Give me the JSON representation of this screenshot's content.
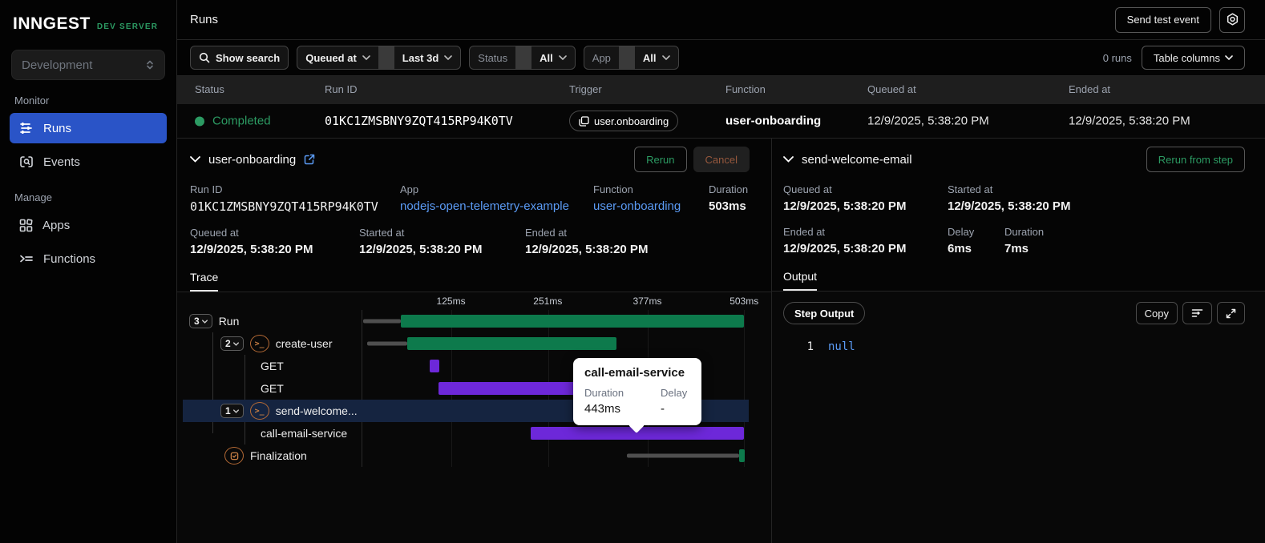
{
  "sidebar": {
    "logo": "INNGEST",
    "logo_badge": "DEV SERVER",
    "env_select": {
      "value": "Development"
    },
    "monitor_label": "Monitor",
    "manage_label": "Manage",
    "items": {
      "runs": "Runs",
      "events": "Events",
      "apps": "Apps",
      "functions": "Functions"
    }
  },
  "topbar": {
    "title": "Runs",
    "send_test_event": "Send test event"
  },
  "filters": {
    "show_search": "Show search",
    "queued_at": "Queued at",
    "time_range": "Last 3d",
    "status_label": "Status",
    "status_value": "All",
    "app_label": "App",
    "app_value": "All",
    "runs_count": "0 runs",
    "table_columns": "Table columns"
  },
  "table": {
    "columns": [
      "Status",
      "Run ID",
      "Trigger",
      "Function",
      "Queued at",
      "Ended at"
    ],
    "row": {
      "status": "Completed",
      "run_id": "01KC1ZMSBNY9ZQT415RP94K0TV",
      "trigger": "user.onboarding",
      "function": "user-onboarding",
      "queued_at": "12/9/2025, 5:38:20 PM",
      "ended_at": "12/9/2025, 5:38:20 PM"
    }
  },
  "run_details": {
    "title": "user-onboarding",
    "rerun": "Rerun",
    "cancel": "Cancel",
    "run_id_label": "Run ID",
    "run_id": "01KC1ZMSBNY9ZQT415RP94K0TV",
    "app_label": "App",
    "app": "nodejs-open-telemetry-example",
    "function_label": "Function",
    "function": "user-onboarding",
    "duration_label": "Duration",
    "duration": "503ms",
    "queued_label": "Queued at",
    "queued": "12/9/2025, 5:38:20 PM",
    "started_label": "Started at",
    "started": "12/9/2025, 5:38:20 PM",
    "ended_label": "Ended at",
    "ended": "12/9/2025, 5:38:20 PM",
    "tab": "Trace"
  },
  "trace": {
    "ticks": [
      {
        "label": "125ms",
        "pos": 23.1
      },
      {
        "label": "251ms",
        "pos": 48.1
      },
      {
        "label": "377ms",
        "pos": 73.8
      },
      {
        "label": "503ms",
        "pos": 98.8
      }
    ],
    "rows": [
      {
        "label": "Run",
        "badge": "3",
        "segments": [
          {
            "kind": "queue",
            "start": 0.4,
            "end": 10.1
          },
          {
            "kind": "span",
            "color": "green",
            "start": 10.1,
            "end": 98.8
          }
        ]
      },
      {
        "label": "create-user",
        "badge": "2",
        "segments": [
          {
            "kind": "queue",
            "start": 1.4,
            "end": 11.8
          },
          {
            "kind": "span",
            "color": "green",
            "start": 11.8,
            "end": 65.9
          }
        ]
      },
      {
        "label": "GET",
        "segments": [
          {
            "kind": "span",
            "color": "purple",
            "start": 17.6,
            "end": 20.0
          }
        ]
      },
      {
        "label": "GET",
        "segments": [
          {
            "kind": "span",
            "color": "purple",
            "start": 19.8,
            "end": 55.8
          }
        ]
      },
      {
        "label": "send-welcome...",
        "badge": "1",
        "highlighted": true,
        "segments": [
          {
            "kind": "span",
            "color": "green",
            "start": 67.4,
            "end": 68.6
          }
        ]
      },
      {
        "label": "call-email-service",
        "segments": [
          {
            "kind": "span",
            "color": "purple",
            "start": 43.6,
            "end": 98.8
          }
        ]
      },
      {
        "label": "Finalization",
        "segments": [
          {
            "kind": "queue",
            "start": 68.6,
            "end": 97.5
          },
          {
            "kind": "span",
            "color": "green",
            "start": 97.5,
            "end": 99.0
          }
        ]
      }
    ],
    "tooltip": {
      "title": "call-email-service",
      "duration_label": "Duration",
      "duration": "443ms",
      "delay_label": "Delay",
      "delay": "-"
    }
  },
  "step_details": {
    "title": "send-welcome-email",
    "rerun_from_step": "Rerun from step",
    "queued_label": "Queued at",
    "queued": "12/9/2025, 5:38:20 PM",
    "started_label": "Started at",
    "started": "12/9/2025, 5:38:20 PM",
    "ended_label": "Ended at",
    "ended": "12/9/2025, 5:38:20 PM",
    "delay_label": "Delay",
    "delay": "6ms",
    "duration_label": "Duration",
    "duration": "7ms",
    "tab": "Output",
    "output": {
      "chip": "Step Output",
      "copy": "Copy",
      "line_number": "1",
      "code": "null"
    }
  },
  "colors": {
    "accent_green": "#2c9b63",
    "bar_green": "#0d7a4c",
    "bar_purple": "#6d28d9",
    "link_blue": "#5b9bf5",
    "active_nav": "#2a54c7",
    "highlight_row": "#152440"
  }
}
